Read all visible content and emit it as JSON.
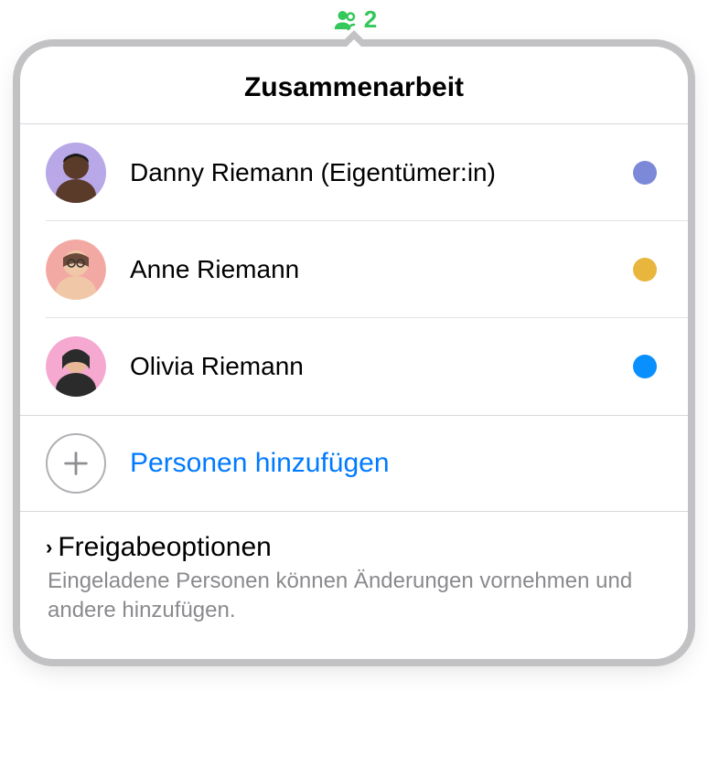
{
  "badge": {
    "count": "2"
  },
  "popover": {
    "title": "Zusammenarbeit",
    "people": [
      {
        "name": "Danny Riemann (Eigentümer:in)",
        "status_color": "#7B89D8",
        "avatar_bg": "#B9A8E8",
        "face_tone": "#5A3A29"
      },
      {
        "name": "Anne Riemann",
        "status_color": "#E8B63C",
        "avatar_bg": "#F3A9A3",
        "face_tone": "#F0C8A8"
      },
      {
        "name": "Olivia Riemann",
        "status_color": "#0A8FFF",
        "avatar_bg": "#F5A8D0",
        "face_tone": "#E8B898"
      }
    ],
    "add_people_label": "Personen hinzufügen",
    "share_options": {
      "title": "Freigabeoptionen",
      "description": "Eingeladene Personen können Änderungen vornehmen und andere hinzufügen."
    }
  }
}
